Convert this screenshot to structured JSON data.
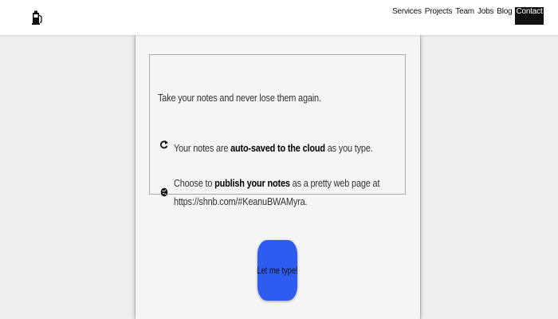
{
  "header": {
    "logo_icon": "fuel-pump-icon",
    "nav": [
      "Services",
      "Projects",
      "Team",
      "Jobs",
      "Blog",
      "Contact"
    ],
    "active_item": "Contact"
  },
  "card": {
    "intro": "Take your notes and never lose them again.",
    "features": [
      {
        "icon": "sync-icon",
        "before": "Your notes are ",
        "bold": "auto-saved to the cloud",
        "after": " as you type."
      },
      {
        "icon": "globe-icon",
        "before": "Choose to ",
        "bold": "publish your notes",
        "after": " as a pretty web page at",
        "line2": "https://shnb.com/#KeanuBWAMyra."
      }
    ],
    "cta_label": "Let me type!"
  },
  "colors": {
    "accent": "#2f5cf0",
    "active_nav_bg": "#111111"
  }
}
